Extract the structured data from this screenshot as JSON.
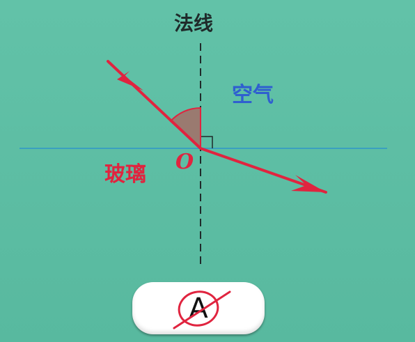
{
  "labels": {
    "normal": "法线",
    "air": "空气",
    "glass": "玻璃",
    "point": "O"
  },
  "answer": {
    "letter": "A"
  },
  "colors": {
    "background": "#5fbfa5",
    "ray": "#e0243f",
    "interface": "#3aa0c0",
    "normal_line": "#1f2a2a",
    "angle_fill": "#9a7a70",
    "air_label": "#2f5fd0",
    "glass_label": "#e0243f"
  }
}
